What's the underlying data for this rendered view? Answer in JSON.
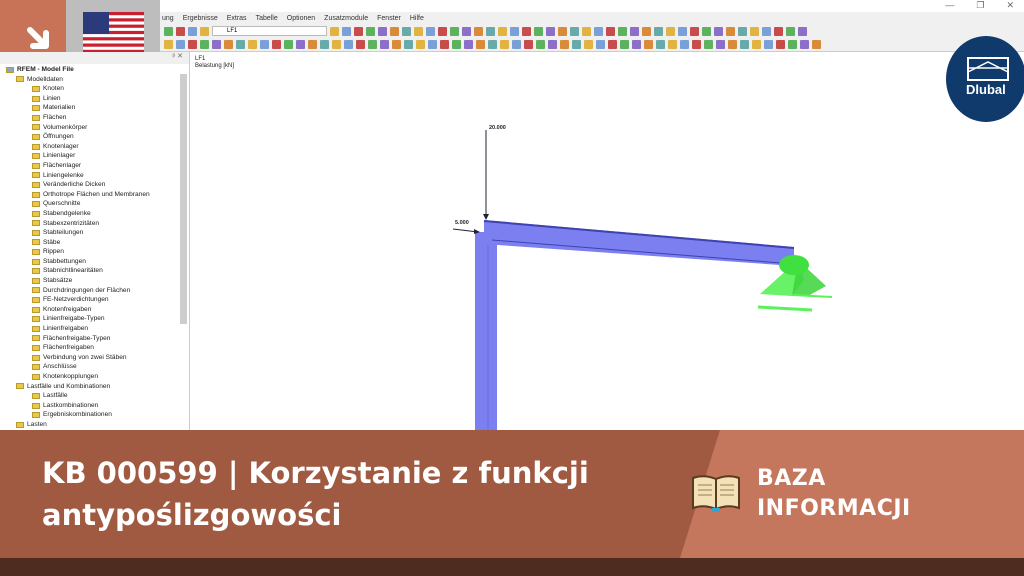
{
  "window": {
    "controls": [
      "minimize",
      "restore",
      "close"
    ]
  },
  "menu": [
    "ung",
    "Ergebnisse",
    "Extras",
    "Tabelle",
    "Optionen",
    "Zusatzmodule",
    "Fenster",
    "Hilfe"
  ],
  "toolbar": {
    "loadcase_combo": "LF1"
  },
  "navigator": {
    "root": "RFEM - Model File",
    "items": [
      {
        "label": "Modelldaten",
        "level": 1
      },
      {
        "label": "Knoten",
        "level": 2
      },
      {
        "label": "Linien",
        "level": 2
      },
      {
        "label": "Materialien",
        "level": 2
      },
      {
        "label": "Flächen",
        "level": 2
      },
      {
        "label": "Volumenkörper",
        "level": 2
      },
      {
        "label": "Öffnungen",
        "level": 2
      },
      {
        "label": "Knotenlager",
        "level": 2
      },
      {
        "label": "Linienlager",
        "level": 2
      },
      {
        "label": "Flächenlager",
        "level": 2
      },
      {
        "label": "Liniengelenke",
        "level": 2
      },
      {
        "label": "Veränderliche Dicken",
        "level": 2
      },
      {
        "label": "Orthotrope Flächen und Membranen",
        "level": 2
      },
      {
        "label": "Querschnitte",
        "level": 2
      },
      {
        "label": "Stabendgelenke",
        "level": 2
      },
      {
        "label": "Stabexzentrizitäten",
        "level": 2
      },
      {
        "label": "Stabteilungen",
        "level": 2
      },
      {
        "label": "Stäbe",
        "level": 2
      },
      {
        "label": "Rippen",
        "level": 2
      },
      {
        "label": "Stabbettungen",
        "level": 2
      },
      {
        "label": "Stabnichtlinearitäten",
        "level": 2
      },
      {
        "label": "Stabsätze",
        "level": 2
      },
      {
        "label": "Durchdringungen der Flächen",
        "level": 2
      },
      {
        "label": "FE-Netzverdichtungen",
        "level": 2
      },
      {
        "label": "Knotenfreigaben",
        "level": 2
      },
      {
        "label": "Linienfreigabe-Typen",
        "level": 2
      },
      {
        "label": "Linienfreigaben",
        "level": 2
      },
      {
        "label": "Flächenfreigabe-Typen",
        "level": 2
      },
      {
        "label": "Flächenfreigaben",
        "level": 2
      },
      {
        "label": "Verbindung von zwei Stäben",
        "level": 2
      },
      {
        "label": "Anschlüsse",
        "level": 2
      },
      {
        "label": "Knotenkopplungen",
        "level": 2
      },
      {
        "label": "Lastfälle und Kombinationen",
        "level": 1
      },
      {
        "label": "Lastfälle",
        "level": 2
      },
      {
        "label": "Lastkombinationen",
        "level": 2
      },
      {
        "label": "Ergebniskombinationen",
        "level": 2
      },
      {
        "label": "Lasten",
        "level": 1
      }
    ]
  },
  "view": {
    "loadcase": "LF1",
    "subtitle": "Belastung [kN]",
    "load_vertical": "20.000",
    "load_horizontal": "5.000"
  },
  "banner": {
    "title": "KB 000599 | Korzystanie z funkcji antypoślizgowości",
    "category_line1": "BAZA",
    "category_line2": "INFORMACJI"
  },
  "logo": {
    "text": "Dlubal"
  },
  "colors": {
    "banner": "#a15a42",
    "banner_accent": "#c4775d",
    "member": "#7b7ff0",
    "support": "#4df04d"
  }
}
